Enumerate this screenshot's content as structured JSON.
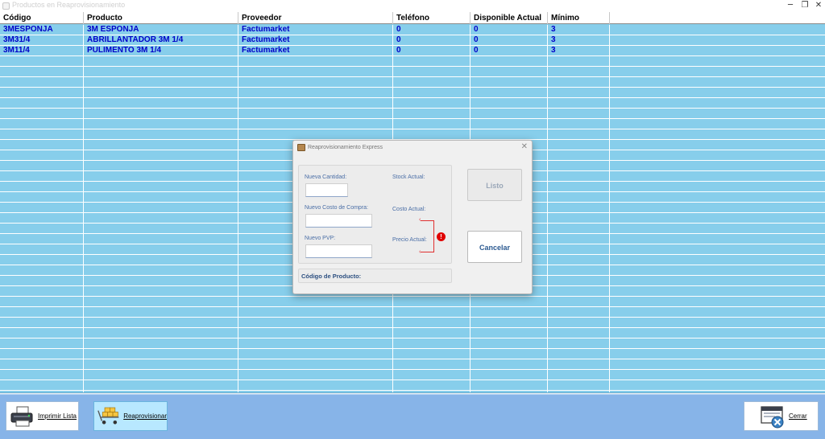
{
  "window": {
    "title": "Productos en Reaprovisionamiento",
    "minimize_glyph": "─",
    "restore_glyph": "❐",
    "close_glyph": "✕"
  },
  "grid": {
    "columns": [
      "Código",
      "Producto",
      "Proveedor",
      "Teléfono",
      "Disponible Actual",
      "Mínimo"
    ],
    "rows": [
      [
        "3MESPONJA",
        "3M ESPONJA",
        "Factumarket",
        "0",
        "0",
        "3"
      ],
      [
        "3M31/4",
        "ABRILLANTADOR 3M 1/4",
        "Factumarket",
        "0",
        "0",
        "3"
      ],
      [
        "3M11/4",
        "PULIMENTO 3M 1/4",
        "Factumarket",
        "0",
        "0",
        "3"
      ]
    ]
  },
  "toolbar": {
    "print_label": "Imprimir Lista",
    "replenish_label": "Reaprovisionar",
    "close_label": "Cerrar"
  },
  "dialog": {
    "title": "Reaprovisionamiento Express",
    "close_glyph": "✕",
    "new_qty_label": "Nueva Cantidad:",
    "new_qty_value": "",
    "new_cost_label": "Nuevo Costo de Compra:",
    "new_cost_value": "",
    "new_pvp_label": "Nuevo PVP:",
    "new_pvp_value": "",
    "stock_label": "Stock Actual:",
    "cost_label": "Costo Actual:",
    "price_label": "Precio Actual:",
    "error_glyph": "!",
    "code_label": "Código de Producto:",
    "ok_label": "Listo",
    "cancel_label": "Cancelar"
  },
  "colors": {
    "grid_background": "#87ceeb",
    "row_text": "#0000c8",
    "toolbar_background": "#87b4e8",
    "error": "#e00000"
  }
}
